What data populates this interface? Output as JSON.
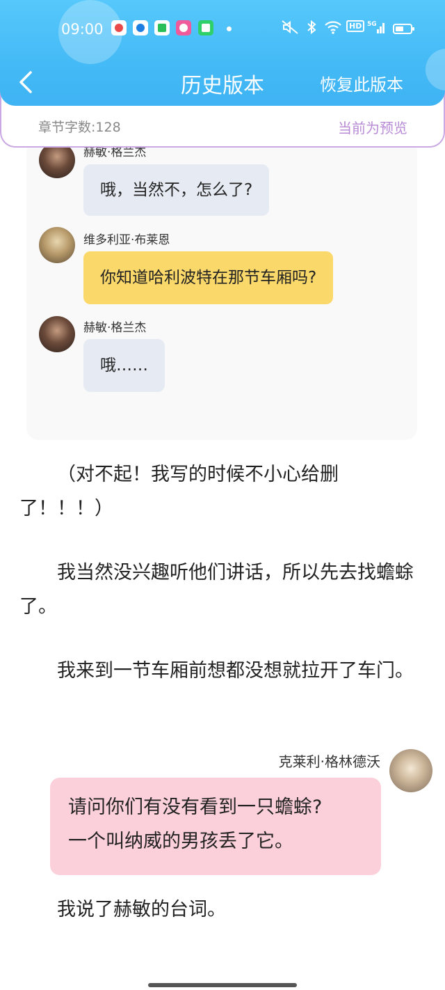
{
  "status_bar": {
    "time": "09:00",
    "icons": [
      "map-pin-icon",
      "compass-icon",
      "video-play-icon",
      "gift-icon",
      "qr-icon"
    ],
    "system_icons": [
      "mute-icon",
      "bluetooth-icon",
      "wifi-icon",
      "hd-icon",
      "5g-signal-icon",
      "battery-icon"
    ],
    "hd": "HD",
    "net": "5G"
  },
  "nav": {
    "title": "历史版本",
    "restore_label": "恢复此版本"
  },
  "info_bar": {
    "word_count": "章节字数:128",
    "preview_label": "当前为预览"
  },
  "chat_card": {
    "messages": [
      {
        "speaker": "赫敏·格兰杰",
        "text": "哦，当然不，怎么了?",
        "color": "#e6ebf3"
      },
      {
        "speaker": "维多利亚·布莱恩",
        "text": "你知道哈利波特在那节车厢吗?",
        "color": "#fbd86a"
      },
      {
        "speaker": "赫敏·格兰杰",
        "text": "哦……",
        "color": "#e6ebf3"
      }
    ]
  },
  "paragraphs": [
    "（对不起！我写的时候不小心给删了！！！）",
    "我当然没兴趣听他们讲话，所以先去找蟾蜍了。",
    "我来到一节车厢前想都没想就拉开了车门。"
  ],
  "right_chat": {
    "speaker": "克莱利·格林德沃",
    "line1": "请问你们有没有看到一只蟾蜍?",
    "line2": "一个叫纳威的男孩丢了它。",
    "color": "#fbd0da"
  },
  "last_paragraph": "我说了赫敏的台词。"
}
